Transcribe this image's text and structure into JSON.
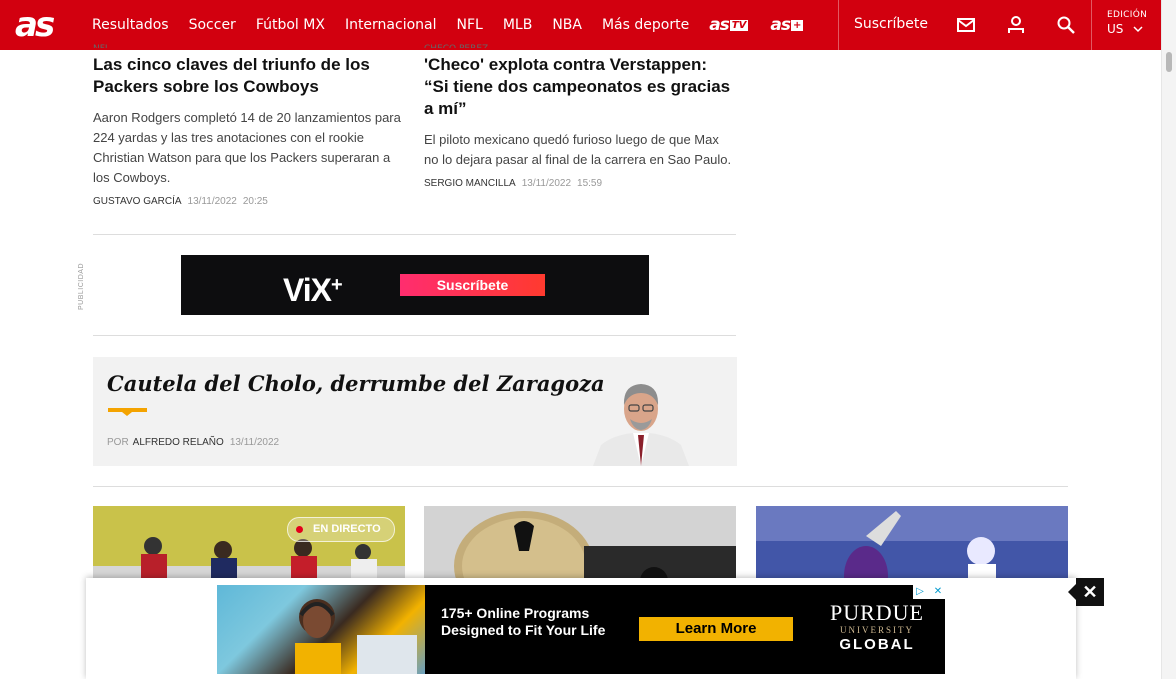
{
  "header": {
    "logo": "as",
    "nav": [
      "Resultados",
      "Soccer",
      "Fútbol MX",
      "Internacional",
      "NFL",
      "MLB",
      "NBA",
      "Más deporte"
    ],
    "brand_tv": "as",
    "brand_tv_tag": "TV",
    "brand_plus": "as",
    "brand_plus_tag": "+",
    "subscribe": "Suscríbete",
    "edition_label": "EDICIÓN",
    "edition_value": "US"
  },
  "articles": [
    {
      "kicker": "NFL",
      "title": "Las cinco claves del triunfo de los Packers sobre los Cowboys",
      "description": "Aaron Rodgers completó 14 de 20 lanzamientos para 224 yardas y las tres anotaciones con el rookie Christian Watson para que los Packers superaran a los Cowboys.",
      "author": "GUSTAVO GARCÍA",
      "date": "13/11/2022",
      "time": "20:25"
    },
    {
      "kicker": "CHECO PÉREZ",
      "title": "'Checo' explota contra Verstappen: “Si tiene dos campeonatos es gracias a mí”",
      "description": "El piloto mexicano quedó furioso luego de que Max no lo dejara pasar al final de la carrera en Sao Paulo.",
      "author": "SERGIO MANCILLA",
      "date": "13/11/2022",
      "time": "15:59"
    }
  ],
  "ad_top": {
    "label": "PUBLICIDAD",
    "logo": "ViX",
    "logo_plus": "+",
    "button": "Suscríbete"
  },
  "opinion": {
    "title": "Cautela del Cholo, derrumbe del Zaragoza",
    "by": "POR",
    "author": "ALFREDO RELAÑO",
    "date": "13/11/2022"
  },
  "live_badge": "EN DIRECTO",
  "ad_bottom": {
    "line1": "175+ Online Programs",
    "line2": "Designed to Fit Your Life",
    "button": "Learn More",
    "brand1": "PURDUE",
    "brand2": "UNIVERSITY",
    "brand3": "GLOBAL",
    "mark_info": "▷",
    "mark_close": "✕"
  },
  "close_label": "✕"
}
